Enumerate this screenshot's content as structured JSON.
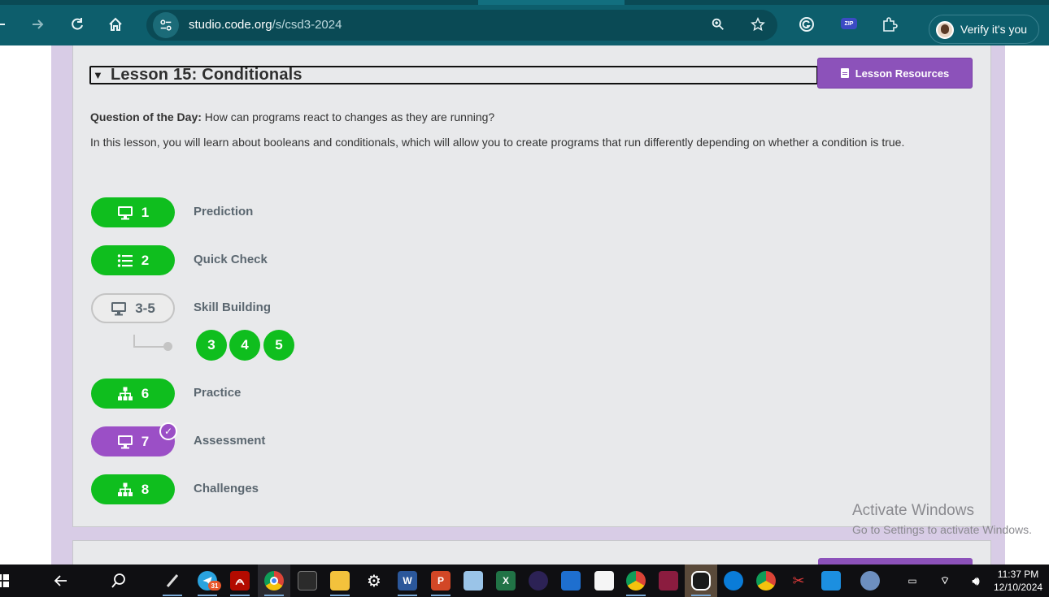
{
  "browser": {
    "url_host": "studio.code.org",
    "url_path": "/s/csd3-2024",
    "profile_button": "Verify it's you",
    "zip_extension_label": "ZIP",
    "icons": [
      "back-arrow-icon",
      "forward-arrow-icon",
      "reload-icon",
      "home-icon",
      "site-info-icon",
      "zoom-icon",
      "bookmark-star-icon",
      "grammarly-icon",
      "zip-extractor-icon",
      "extensions-puzzle-icon"
    ]
  },
  "lesson": {
    "title": "Lesson 15: Conditionals",
    "resources_button": "Lesson Resources",
    "qotd_label": "Question of the Day:",
    "qotd_text": "How can programs react to changes as they are running?",
    "description": "In this lesson, you will learn about booleans and conditionals, which will allow you to create programs that run differently depending on whether a condition is true.",
    "activities": [
      {
        "number": "1",
        "label": "Prediction",
        "icon": "monitor-icon",
        "style": "green"
      },
      {
        "number": "2",
        "label": "Quick Check",
        "icon": "list-icon",
        "style": "green"
      },
      {
        "number": "3-5",
        "label": "Skill Building",
        "icon": "monitor-icon",
        "style": "outline"
      },
      {
        "number": "6",
        "label": "Practice",
        "icon": "hierarchy-icon",
        "style": "green"
      },
      {
        "number": "7",
        "label": "Assessment",
        "icon": "monitor-icon",
        "style": "purple",
        "completed_check": true
      },
      {
        "number": "8",
        "label": "Challenges",
        "icon": "hierarchy-icon",
        "style": "green"
      }
    ],
    "sublevels": [
      "3",
      "4",
      "5"
    ]
  },
  "watermark": {
    "line1": "Activate Windows",
    "line2": "Go to Settings to activate Windows."
  },
  "taskbar": {
    "telegram_badge": "31",
    "clock_time": "11:37 PM",
    "clock_date": "12/10/2024"
  },
  "colors": {
    "chrome": "#0d5e6c",
    "green": "#0fbe1e",
    "purple": "#9b4fc6",
    "resources_purple": "#8c52ba",
    "page_purple": "#d8cce6"
  }
}
